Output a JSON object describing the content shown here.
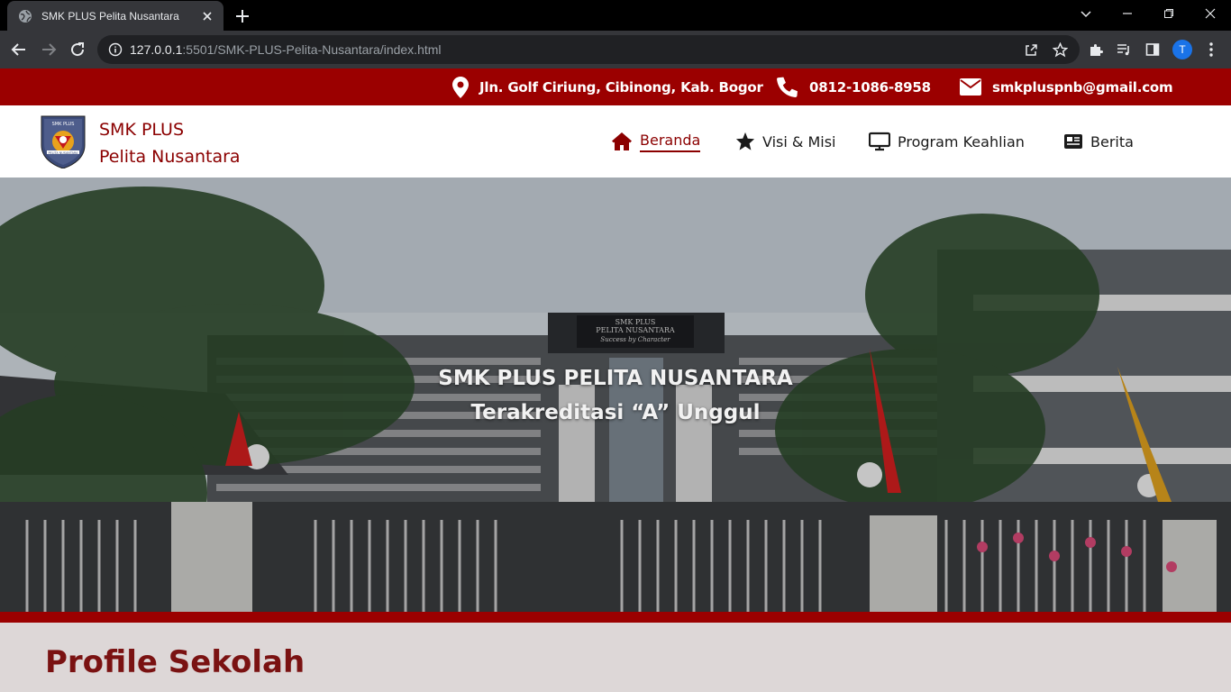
{
  "browser": {
    "tab_title": "SMK PLUS Pelita Nusantara",
    "url_host": "127.0.0.1",
    "url_path": ":5501/SMK-PLUS-Pelita-Nusantara/index.html",
    "profile_initial": "T"
  },
  "topbar": {
    "address": "Jln. Golf Ciriung, Cibinong, Kab. Bogor",
    "phone": "0812-1086-8958",
    "email": "smkpluspnb@gmail.com",
    "icons": [
      "location-pin-icon",
      "phone-icon",
      "envelope-icon"
    ]
  },
  "navbar": {
    "brand_line1": "SMK PLUS",
    "brand_line2": "Pelita Nusantara",
    "items": [
      {
        "label": "Beranda",
        "icon": "home-icon",
        "active": true
      },
      {
        "label": "Visi & Misi",
        "icon": "star-icon",
        "active": false
      },
      {
        "label": "Program Keahlian",
        "icon": "monitor-icon",
        "active": false
      },
      {
        "label": "Berita",
        "icon": "newspaper-icon",
        "active": false
      }
    ]
  },
  "hero": {
    "title": "SMK PLUS PELITA NUSANTARA",
    "subtitle": "Terakreditasi “A” Unggul",
    "building_sign_line1": "SMK PLUS",
    "building_sign_line2": "PELITA NUSANTARA",
    "building_sign_line3": "Success by Character"
  },
  "section": {
    "title": "Profile Sekolah"
  },
  "colors": {
    "brand_red": "#9b0000",
    "brand_dark_red": "#8b0000",
    "section_bg": "#ddd7d7"
  }
}
